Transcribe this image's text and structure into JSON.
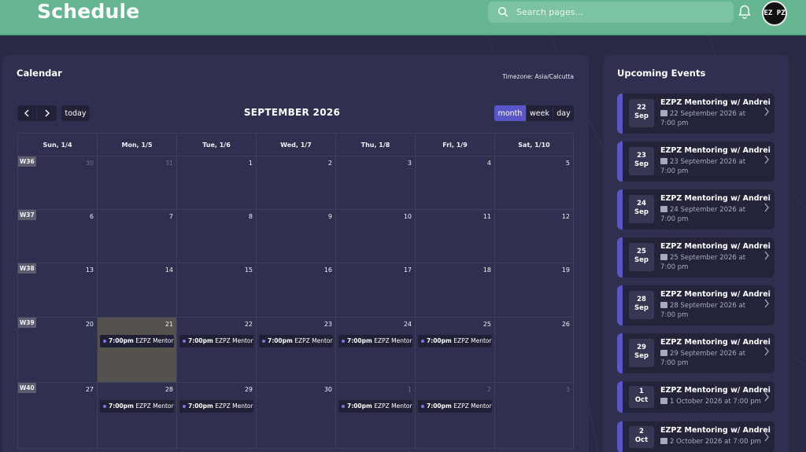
{
  "header": {
    "title": "Schedule",
    "search_placeholder": "Search pages...",
    "avatar_text": "EZ PZ"
  },
  "calendar": {
    "title": "Calendar",
    "timezone": "Timezone: Asia/Calcutta",
    "today_label": "today",
    "month_title": "SEPTEMBER 2026",
    "views": {
      "month": "month",
      "week": "week",
      "day": "day"
    },
    "day_headers": [
      "Sun, 1/4",
      "Mon, 1/5",
      "Tue, 1/6",
      "Wed, 1/7",
      "Thu, 1/8",
      "Fri, 1/9",
      "Sat, 1/10"
    ],
    "weeks": [
      {
        "label": "W36",
        "days": [
          "30",
          "31",
          "1",
          "2",
          "3",
          "4",
          "5"
        ]
      },
      {
        "label": "W37",
        "days": [
          "6",
          "7",
          "8",
          "9",
          "10",
          "11",
          "12"
        ]
      },
      {
        "label": "W38",
        "days": [
          "13",
          "14",
          "15",
          "16",
          "17",
          "18",
          "19"
        ]
      },
      {
        "label": "W39",
        "days": [
          "20",
          "21",
          "22",
          "23",
          "24",
          "25",
          "26"
        ]
      },
      {
        "label": "W40",
        "days": [
          "27",
          "28",
          "29",
          "30",
          "1",
          "2",
          "3"
        ]
      }
    ],
    "event": {
      "time": "7:00pm",
      "title": "EZPZ Mentor"
    }
  },
  "upcoming": {
    "title": "Upcoming Events",
    "items": [
      {
        "day": "22",
        "month": "Sep",
        "name": "EZPZ Mentoring w/ Andrei",
        "when": "22 September 2026 at 7:00 pm"
      },
      {
        "day": "23",
        "month": "Sep",
        "name": "EZPZ Mentoring w/ Andrei",
        "when": "23 September 2026 at 7:00 pm"
      },
      {
        "day": "24",
        "month": "Sep",
        "name": "EZPZ Mentoring w/ Andrei",
        "when": "24 September 2026 at 7:00 pm"
      },
      {
        "day": "25",
        "month": "Sep",
        "name": "EZPZ Mentoring w/ Andrei",
        "when": "25 September 2026 at 7:00 pm"
      },
      {
        "day": "28",
        "month": "Sep",
        "name": "EZPZ Mentoring w/ Andrei",
        "when": "28 September 2026 at 7:00 pm"
      },
      {
        "day": "29",
        "month": "Sep",
        "name": "EZPZ Mentoring w/ Andrei",
        "when": "29 September 2026 at 7:00 pm"
      },
      {
        "day": "1",
        "month": "Oct",
        "name": "EZPZ Mentoring w/ Andrei",
        "when": "1 October 2026 at 7:00 pm"
      },
      {
        "day": "2",
        "month": "Oct",
        "name": "EZPZ Mentoring w/ Andrei",
        "when": "2 October 2026 at 7:00 pm"
      }
    ]
  },
  "colors": {
    "header_bg": "#65b690",
    "page_bg": "#292a43",
    "card_bg": "#2f3050",
    "accent": "#5a56c8",
    "today_cell": "#55524e"
  }
}
